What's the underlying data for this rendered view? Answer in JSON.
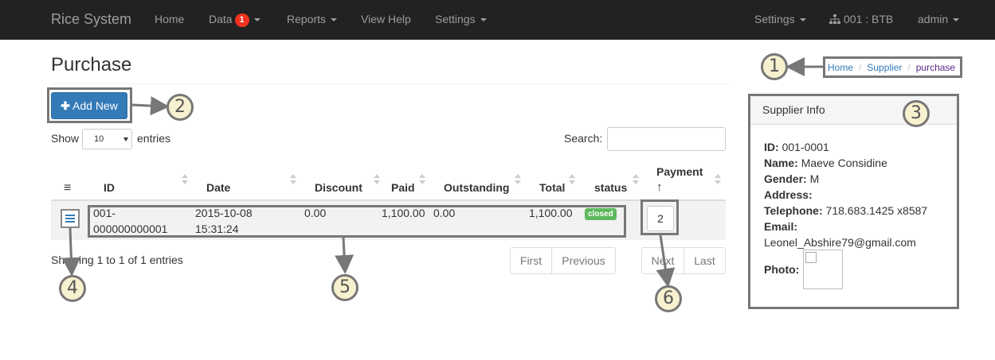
{
  "navbar": {
    "brand": "Rice System",
    "home": "Home",
    "data": "Data",
    "data_badge": "1",
    "reports": "Reports",
    "view_help": "View Help",
    "settings": "Settings",
    "settings_right": "Settings",
    "branch": "001 : BTB",
    "user": "admin"
  },
  "page": {
    "title": "Purchase",
    "breadcrumb": [
      "Home",
      "Supplier",
      "purchase"
    ]
  },
  "toolbar": {
    "add_new": "Add New",
    "show": "Show",
    "entries_value": "10",
    "entries": "entries",
    "search_label": "Search:",
    "search_value": ""
  },
  "table": {
    "headers": {
      "menu": "≡",
      "id": "ID",
      "date": "Date",
      "discount": "Discount",
      "paid": "Paid",
      "outstanding": "Outstanding",
      "total": "Total",
      "status": "status",
      "payment": "Payment",
      "payment_sort": "↑"
    },
    "rows": [
      {
        "id_line1": "001-",
        "id_line2": "000000000001",
        "date_line1": "2015-10-08",
        "date_line2": "15:31:24",
        "discount": "0.00",
        "paid": "1,100.00",
        "outstanding": "0.00",
        "total": "1,100.00",
        "status": "closed",
        "payment": "2"
      }
    ],
    "showing": "Showing 1 to 1 of 1 entries",
    "pagination": {
      "first": "First",
      "previous": "Previous",
      "next": "Next",
      "last": "Last"
    }
  },
  "supplier": {
    "heading": "Supplier Info",
    "id_label": "ID:",
    "id_value": "001-0001",
    "name_label": "Name:",
    "name_value": "Maeve Considine",
    "gender_label": "Gender:",
    "gender_value": "M",
    "address_label": "Address:",
    "address_value": "",
    "telephone_label": "Telephone:",
    "telephone_value": "718.683.1425 x8587",
    "email_label": "Email:",
    "email_value": "Leonel_Abshire79@gmail.com",
    "photo_label": "Photo:"
  },
  "callouts": [
    "1",
    "2",
    "3",
    "4",
    "5",
    "6"
  ],
  "colors": {
    "navbar_bg": "#222222",
    "primary": "#337ab7",
    "success": "#5cb85c",
    "badge": "#f0321e",
    "callout_fill": "#f7f1cf",
    "annotation_stroke": "#777777"
  }
}
